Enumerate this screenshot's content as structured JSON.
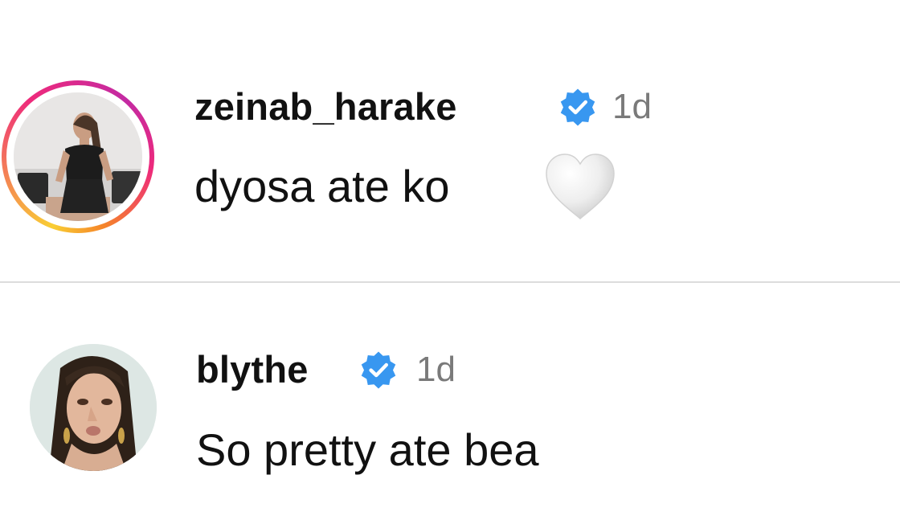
{
  "comments": [
    {
      "username": "zeinab_harake",
      "verified": true,
      "time": "1d",
      "text": "dyosa ate ko",
      "emoji": "white-heart-icon",
      "has_story_ring": true
    },
    {
      "username": "blythe",
      "verified": true,
      "time": "1d",
      "text": "So pretty ate bea",
      "has_story_ring": false
    }
  ],
  "colors": {
    "verified_badge": "#3897f0",
    "timestamp": "#7a7a7a",
    "divider": "#dcdcdc",
    "story_ring": [
      "#f9ce34",
      "#ee2a7b",
      "#c32aa3"
    ]
  }
}
